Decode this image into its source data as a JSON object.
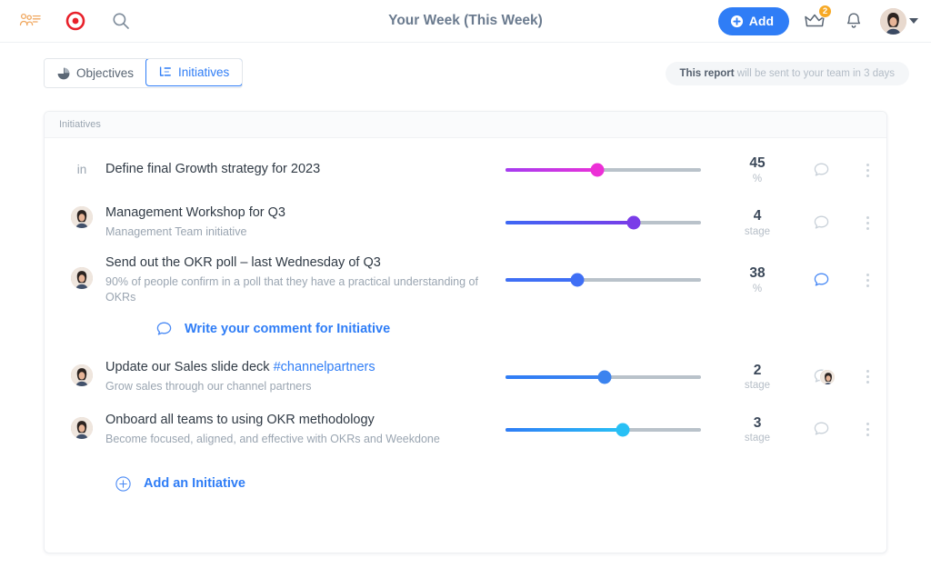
{
  "header": {
    "title": "Your Week (This Week)",
    "team_icon": "team-list-icon",
    "target_icon": "target-icon",
    "search_icon": "search-icon",
    "add_label": "Add",
    "add_icon": "plus-circle-icon",
    "crown_icon": "crown-icon",
    "crown_badge": "2",
    "bell_icon": "bell-icon",
    "avatar_icon": "user-avatar",
    "caret_icon": "chevron-down-icon",
    "accent_color": "#2f7df6",
    "badge_color": "#f7a925"
  },
  "tabs": [
    {
      "label": "Objectives",
      "icon": "pie-chart-icon",
      "active": false
    },
    {
      "label": "Initiatives",
      "icon": "hierarchy-list-icon",
      "active": true
    }
  ],
  "report_notice": {
    "bold": "This report",
    "rest": " will be sent to your team in 3 days"
  },
  "card": {
    "header": "Initiatives",
    "add_initiative": {
      "label": "Add an Initiative",
      "icon": "plus-circle-outline-icon"
    },
    "comment_compose": {
      "label": "Write your comment for Initiative",
      "icon": "comment-bubble-icon"
    },
    "rows": [
      {
        "avatar": "initials",
        "initials": "in",
        "title": "Define final Growth strategy for 2023",
        "subtitle": "",
        "hashtag": "",
        "value": "45",
        "unit": "%",
        "progress": 47,
        "fill_from": "#a53cf0",
        "fill_to": "#e832d9",
        "thumb_color": "#ec2fd6",
        "comment_icon": "comment-bubble-icon",
        "comment_active": false,
        "comment_avatar": false,
        "menu_icon": "more-vertical-icon"
      },
      {
        "avatar": "photo",
        "initials": "",
        "title": "Management Workshop for Q3",
        "subtitle": "Management Team initiative",
        "hashtag": "",
        "value": "4",
        "unit": "stage",
        "progress": 66,
        "fill_from": "#3d68f5",
        "fill_to": "#7a3ce8",
        "thumb_color": "#7a3ce8",
        "comment_icon": "comment-bubble-icon",
        "comment_active": false,
        "comment_avatar": false,
        "menu_icon": "more-vertical-icon"
      },
      {
        "avatar": "photo",
        "initials": "",
        "title": "Send out the OKR poll – last Wednesday of Q3",
        "subtitle": "90% of people confirm in a poll that they have a practical understanding of OKRs",
        "hashtag": "",
        "value": "38",
        "unit": "%",
        "progress": 37,
        "fill_from": "#3f6ff5",
        "fill_to": "#3f6ff5",
        "thumb_color": "#3f6ff5",
        "comment_icon": "comment-bubble-icon",
        "comment_active": true,
        "comment_avatar": false,
        "menu_icon": "more-vertical-icon"
      },
      {
        "avatar": "photo",
        "initials": "",
        "title": "Update our Sales slide deck ",
        "subtitle": "Grow sales through our channel partners",
        "hashtag": "#channelpartners",
        "value": "2",
        "unit": "stage",
        "progress": 51,
        "fill_from": "#2f7df6",
        "fill_to": "#3b83ef",
        "thumb_color": "#3b83ef",
        "comment_icon": "comment-bubble-icon",
        "comment_active": false,
        "comment_avatar": true,
        "menu_icon": "more-vertical-icon"
      },
      {
        "avatar": "photo",
        "initials": "",
        "title": "Onboard all teams to using OKR methodology",
        "subtitle": "Become focused, aligned, and effective with OKRs and Weekdone",
        "hashtag": "",
        "value": "3",
        "unit": "stage",
        "progress": 60,
        "fill_from": "#2f7df6",
        "fill_to": "#28c0f5",
        "thumb_color": "#28c0f5",
        "comment_icon": "comment-bubble-icon",
        "comment_active": false,
        "comment_avatar": false,
        "menu_icon": "more-vertical-icon"
      }
    ]
  }
}
